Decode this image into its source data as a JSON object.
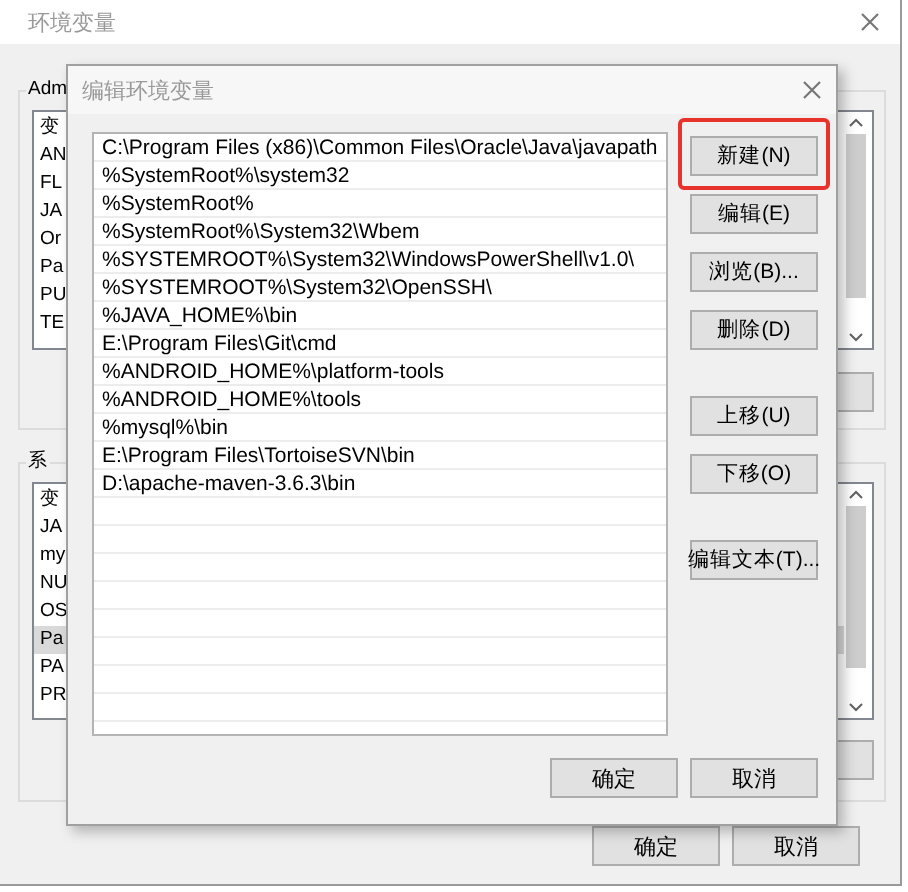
{
  "background_window": {
    "title": "环境变量",
    "groups": [
      {
        "label": "Adm",
        "header": "变",
        "rows": [
          {
            "text": "AN",
            "selected": false
          },
          {
            "text": "FL",
            "selected": false
          },
          {
            "text": "JA",
            "selected": false
          },
          {
            "text": "Or",
            "selected": false
          },
          {
            "text": "Pa",
            "selected": false
          },
          {
            "text": "PU",
            "selected": false
          },
          {
            "text": "TE",
            "selected": false
          }
        ]
      },
      {
        "label": "系",
        "header": "变",
        "rows": [
          {
            "text": "JA",
            "selected": false
          },
          {
            "text": "my",
            "selected": false
          },
          {
            "text": "NU",
            "selected": false
          },
          {
            "text": "OS",
            "selected": false
          },
          {
            "text": "Pa",
            "selected": true
          },
          {
            "text": "PA",
            "selected": false
          },
          {
            "text": "PR",
            "selected": false
          }
        ]
      }
    ],
    "buttons": [
      "确定",
      "取消"
    ]
  },
  "dialog": {
    "title": "编辑环境变量",
    "paths": [
      "C:\\Program Files (x86)\\Common Files\\Oracle\\Java\\javapath",
      "%SystemRoot%\\system32",
      "%SystemRoot%",
      "%SystemRoot%\\System32\\Wbem",
      "%SYSTEMROOT%\\System32\\WindowsPowerShell\\v1.0\\",
      "%SYSTEMROOT%\\System32\\OpenSSH\\",
      "%JAVA_HOME%\\bin",
      "E:\\Program Files\\Git\\cmd",
      "%ANDROID_HOME%\\platform-tools",
      "%ANDROID_HOME%\\tools",
      "%mysql%\\bin",
      "E:\\Program Files\\TortoiseSVN\\bin",
      "D:\\apache-maven-3.6.3\\bin"
    ],
    "button_groups": [
      [
        {
          "label": "新建(N)",
          "highlighted": true
        },
        {
          "label": "编辑(E)",
          "highlighted": false
        },
        {
          "label": "浏览(B)...",
          "highlighted": false
        },
        {
          "label": "删除(D)",
          "highlighted": false
        }
      ],
      [
        {
          "label": "上移(U)",
          "highlighted": false
        },
        {
          "label": "下移(O)",
          "highlighted": false
        }
      ],
      [
        {
          "label": "编辑文本(T)...",
          "highlighted": false
        }
      ]
    ],
    "buttons": [
      "确定",
      "取消"
    ]
  }
}
